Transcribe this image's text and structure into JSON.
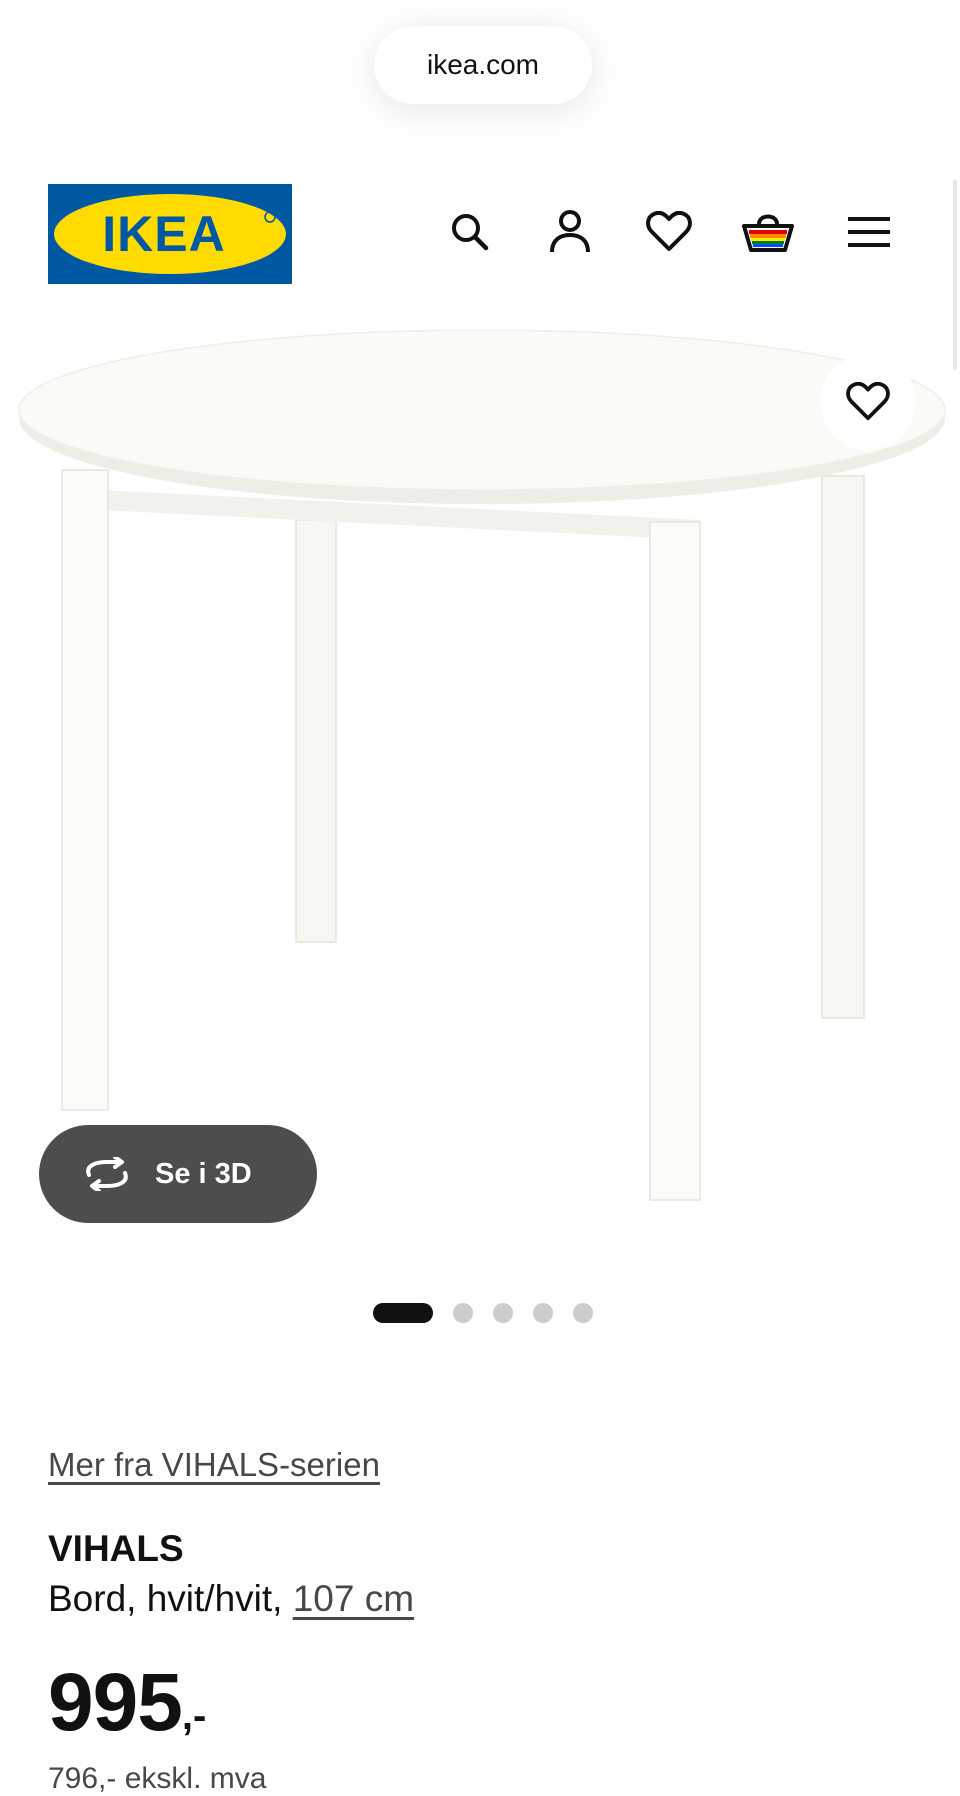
{
  "browser": {
    "url": "ikea.com"
  },
  "header": {
    "logo_text": "IKEA",
    "brand_colors": {
      "blue": "#0058A3",
      "yellow": "#FFDB00"
    },
    "icons": [
      "search-icon",
      "account-icon",
      "favourites-icon",
      "cart-icon",
      "menu-icon"
    ]
  },
  "gallery": {
    "view_3d_label": "Se i 3D",
    "slide_count": 5,
    "active_slide": 1
  },
  "product": {
    "series_link": "Mer fra VIHALS-serien",
    "name": "VIHALS",
    "description": "Bord, hvit/hvit, ",
    "size_link": "107 cm",
    "price_main": "995",
    "price_suffix": ",-",
    "price_ex_vat": "796,- ekskl. mva"
  }
}
